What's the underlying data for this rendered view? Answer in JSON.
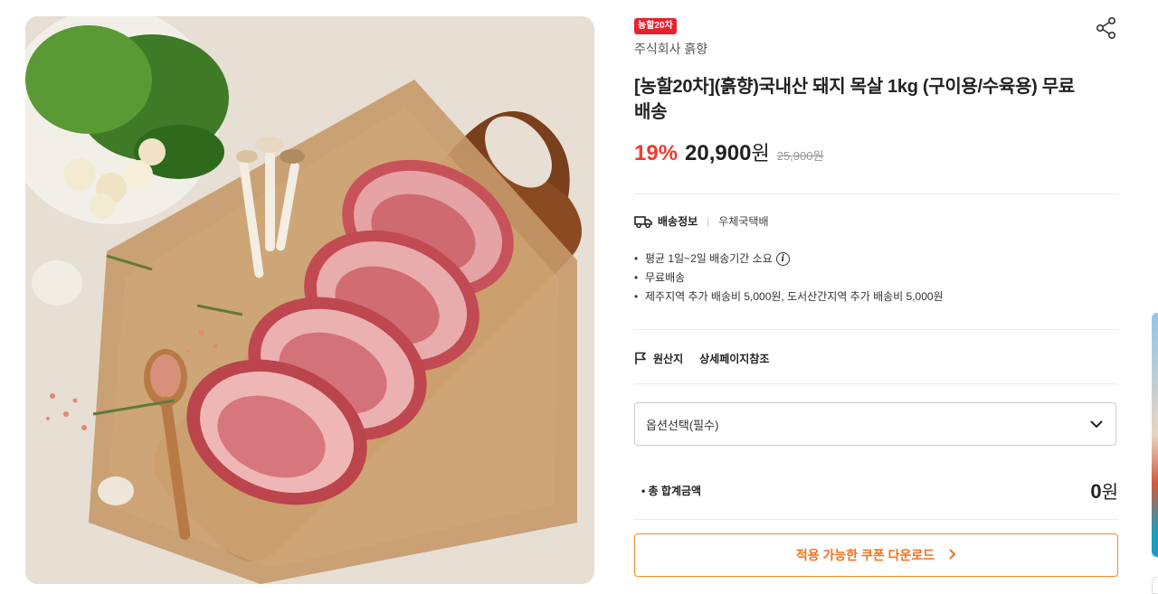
{
  "product": {
    "badge": "농할20차",
    "seller": "주식회사 흙향",
    "title": "[농할20차](흙향)국내산 돼지 목살 1kg (구이용/수육용) 무료배송",
    "discount": "19%",
    "price": "20,900",
    "price_unit": "원",
    "original_price": "25,900원",
    "image_icon": "pork-neck-meat-photo"
  },
  "shipping": {
    "label": "배송정보",
    "carrier": "우체국택배",
    "notes": [
      "평균 1일~2일 배송기간 소요",
      "무료배송",
      "제주지역 추가 배송비 5,000원, 도서산간지역 추가 배송비 5,000원"
    ]
  },
  "origin": {
    "label": "원산지",
    "value": "상세페이지참조"
  },
  "option_select": {
    "placeholder": "옵션선택(필수)"
  },
  "total": {
    "label": "총 합계금액",
    "amount": "0",
    "unit": "원"
  },
  "coupon": {
    "label": "적용 가능한 쿠폰 다운로드"
  },
  "colors": {
    "badge_red": "#e8222d",
    "discount_red": "#ef3b2d",
    "coupon_orange": "#f0711e"
  }
}
